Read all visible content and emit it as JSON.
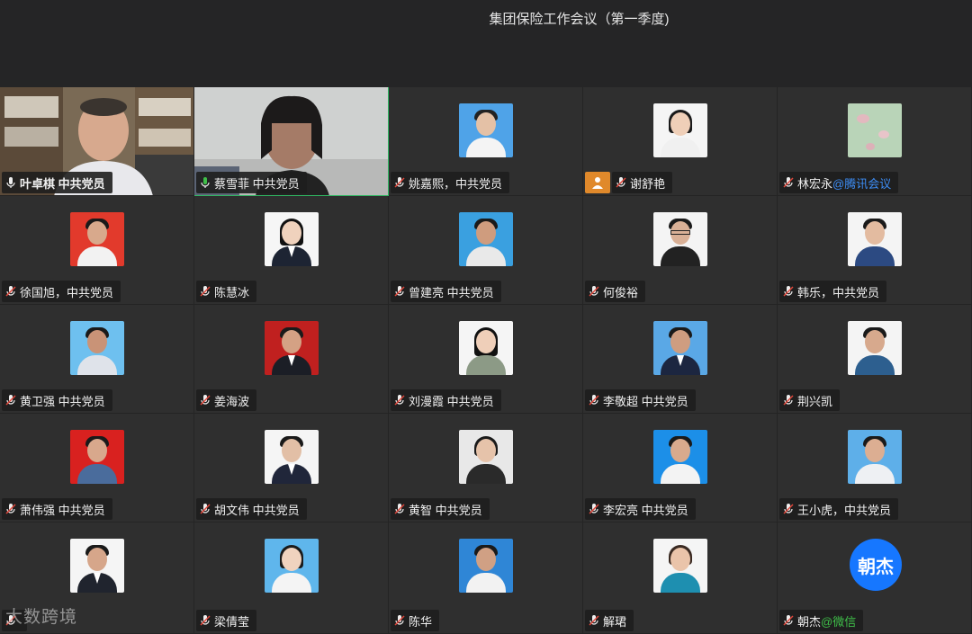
{
  "meeting": {
    "title": "集团保险工作会议（第一季度)"
  },
  "colors": {
    "accent_green": "#2fb862",
    "badge_orange": "#e0892b",
    "link_blue": "#3d8ef7",
    "wechat_green": "#3fbf49",
    "tile_bg": "#2f2f2f"
  },
  "participants": [
    {
      "name": "叶卓棋 中共党员",
      "mic": "on",
      "video": true
    },
    {
      "name": "蔡雪菲 中共党员",
      "mic": "on",
      "video": true,
      "speaking": true
    },
    {
      "name": "姚嘉熙，中共党员",
      "mic": "muted"
    },
    {
      "name": "谢舒艳",
      "mic": "muted",
      "host": true
    },
    {
      "name": "林宏永",
      "suffix": "@腾讯会议",
      "mic": "muted"
    },
    {
      "name": "徐国旭，中共党员",
      "mic": "muted"
    },
    {
      "name": "陈慧冰",
      "mic": "muted"
    },
    {
      "name": "曾建亮 中共党员",
      "mic": "muted"
    },
    {
      "name": "何俊裕",
      "mic": "muted"
    },
    {
      "name": "韩乐，中共党员",
      "mic": "muted"
    },
    {
      "name": "黄卫强 中共党员",
      "mic": "muted"
    },
    {
      "name": "姜海波",
      "mic": "muted"
    },
    {
      "name": "刘漫霞 中共党员",
      "mic": "muted"
    },
    {
      "name": "李敬超 中共党员",
      "mic": "muted"
    },
    {
      "name": "荆兴凯",
      "mic": "muted"
    },
    {
      "name": "萧伟强 中共党员",
      "mic": "muted"
    },
    {
      "name": "胡文伟 中共党员",
      "mic": "muted"
    },
    {
      "name": "黄智 中共党员",
      "mic": "muted"
    },
    {
      "name": "李宏亮 中共党员",
      "mic": "muted"
    },
    {
      "name": "王小虎，中共党员",
      "mic": "muted"
    },
    {
      "name": "",
      "mic": "muted"
    },
    {
      "name": "梁倩莹",
      "mic": "muted"
    },
    {
      "name": "陈华",
      "mic": "muted"
    },
    {
      "name": "解珺",
      "mic": "muted"
    },
    {
      "name": "朝杰",
      "suffix": "@微信",
      "mic": "muted",
      "circle_avatar": "朝杰"
    }
  ],
  "watermark": "大数跨境"
}
